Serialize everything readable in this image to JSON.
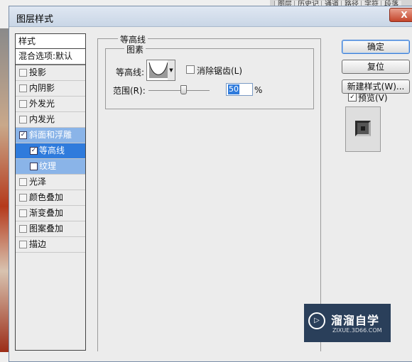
{
  "background": {
    "tabs": [
      "图层",
      "历史记",
      "通道",
      "路径",
      "字符",
      "段落"
    ]
  },
  "dialog": {
    "title": "图层样式",
    "close_label": "X"
  },
  "styles": {
    "header": "样式",
    "blend_options": "混合选项:默认",
    "items": [
      {
        "label": "投影",
        "checked": false
      },
      {
        "label": "内阴影",
        "checked": false
      },
      {
        "label": "外发光",
        "checked": false
      },
      {
        "label": "内发光",
        "checked": false
      },
      {
        "label": "斜面和浮雕",
        "checked": true
      },
      {
        "label": "等高线",
        "checked": true
      },
      {
        "label": "纹理",
        "checked": false
      },
      {
        "label": "光泽",
        "checked": false
      },
      {
        "label": "颜色叠加",
        "checked": false
      },
      {
        "label": "渐变叠加",
        "checked": false
      },
      {
        "label": "图案叠加",
        "checked": false
      },
      {
        "label": "描边",
        "checked": false
      }
    ],
    "check_mark": "✓"
  },
  "contour_section": {
    "group_title": "等高线",
    "elements_title": "图素",
    "contour_label": "等高线:",
    "anti_alias_label": "消除锯齿(L)",
    "range_label": "范围(R):",
    "range_value": "50",
    "range_unit": "%",
    "range_fraction": 0.5
  },
  "buttons": {
    "ok": "确定",
    "reset": "复位",
    "new_style": "新建样式(W)...",
    "preview_label": "预览(V)"
  },
  "watermark": {
    "title": "溜溜自学",
    "subtitle": "ZIXUE.3D66.COM",
    "icon_glyph": "▷"
  }
}
